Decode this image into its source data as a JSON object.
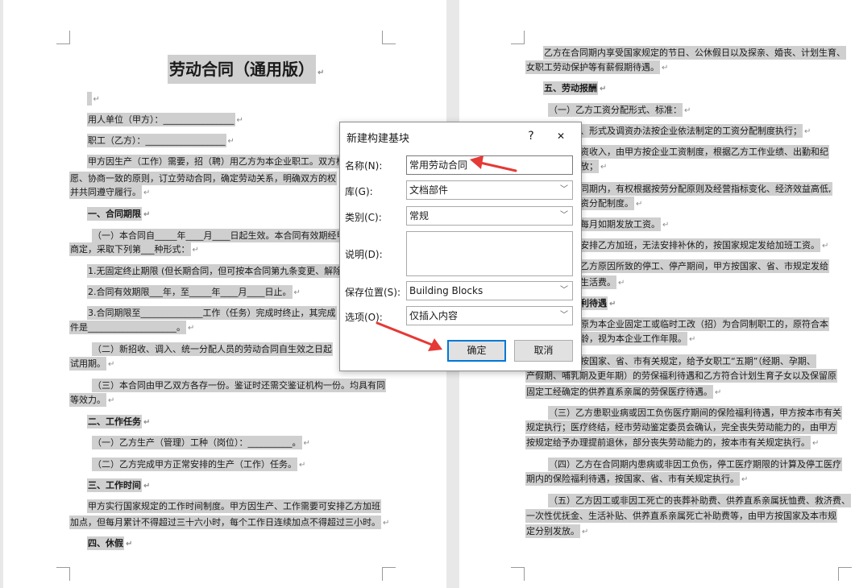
{
  "left_page": {
    "title": "劳动合同（通用版）",
    "lines": [
      "用人单位（甲方）：________________",
      "职工（乙方）：__________________",
      "甲方因生产（工作）需要，招（聘）用乙方为本企业职工。双方根",
      "愿、协商一致的原则，订立劳动合同，确定劳动关系，明确双方的权",
      "并共同遵守履行。",
      "一、合同期限",
      "（一）本合同自_____年____月____日起生效。本合同有效期经甲",
      "商定，采取下列第___种形式：",
      "1.无固定终止期限 (但长期合同，但可按本合同第九条变更、解除",
      "2.合同有效期限___年，至_____年____月____日止。",
      "3.合同期限至______________工作（任务）完成时终止，其完成",
      "件是____________________。",
      "（二）新招收、调入、统一分配人员的劳动合同自生效之日起",
      "试用期。",
      "（三）本合同由甲乙双方各存一份。鉴证时还需交鉴证机构一份。均具有同",
      "等效力。",
      "二、工作任务",
      "（一）乙方生产（管理）工种（岗位）：__________。",
      "（二）乙方完成甲方正常安排的生产（工作）任务。",
      "三、工作时间",
      "甲方实行国家规定的工作时间制度。甲方因生产、工作需要可安排乙方加班",
      "加点，但每月累计不得超过三十六小时，每个工作日连续加点不得超过三小时。",
      "四、休假"
    ]
  },
  "right_page": {
    "lines": [
      "乙方在合同期内享受国家规定的节日、公休假日以及探亲、婚丧、计划生育、",
      "女职工劳动保护等有薪假期待遇。",
      "五、劳动报酬",
      "（一）乙方工资分配形式、标准：",
      "准、形式及调资办法按企业依法制定的工资分配制度执行；",
      "工资收入，由甲方按企业工资制度，根据乙方工作业绩、出勤和纪",
      "发放；",
      "合同期内，有权根据按劳分配原则及经营指标变化、经济效益高低,",
      "工资分配制度。",
      "方每月如期发放工资。",
      "方安排乙方加班，无法安排补休的，按国家规定发给加班工资。",
      "因乙方原因所致的停工、停产期间，甲方按国家、省、市规定发给",
      "或生活费。",
      "福利待遇",
      "方原为本企业固定工或临时工改（招）为合同制职工的，原符合本",
      "工龄，视为本企业工作年限。",
      "方按国家、省、市有关规定，给予女职工“五期”（经期、孕期、",
      "产假期、哺乳期及更年期）的劳保福利待遇和乙方符合计划生育子女以及保留原",
      "固定工经确定的供养直系亲属的劳保医疗待遇。",
      "（三）乙方患职业病或因工负伤医疗期间的保险福利待遇，甲方按本市有关",
      "规定执行；医疗终结，经市劳动鉴定委员会确认，完全丧失劳动能力的，由甲方",
      "按规定给予办理提前退休，部分丧失劳动能力的，按本市有关规定执行。",
      "（四）乙方在合同期内患病或非因工负伤，停工医疗期限的计算及停工医疗",
      "期内的保险福利待遇，按国家、省、市有关规定执行。",
      "（五）乙方因工或非因工死亡的丧葬补助费、供养直系亲属抚恤费、救济费、",
      "一次性优抚金、生活补贴、供养直系亲属死亡补助费等，由甲方按国家及本市规",
      "定分别发放。"
    ]
  },
  "dialog": {
    "title": "新建构建基块",
    "help": "?",
    "close": "✕",
    "name_label": "名称(N):",
    "name_value": "常用劳动合同",
    "gallery_label": "库(G):",
    "gallery_value": "文档部件",
    "category_label": "类别(C):",
    "category_value": "常规",
    "description_label": "说明(D):",
    "description_value": "",
    "save_label": "保存位置(S):",
    "save_value": "Building Blocks",
    "options_label": "选项(O):",
    "options_value": "仅插入内容",
    "ok": "确定",
    "cancel": "取消"
  },
  "colors": {
    "highlight": "#cfcfcf",
    "accent": "#0078d7",
    "arrow": "#e53935"
  }
}
